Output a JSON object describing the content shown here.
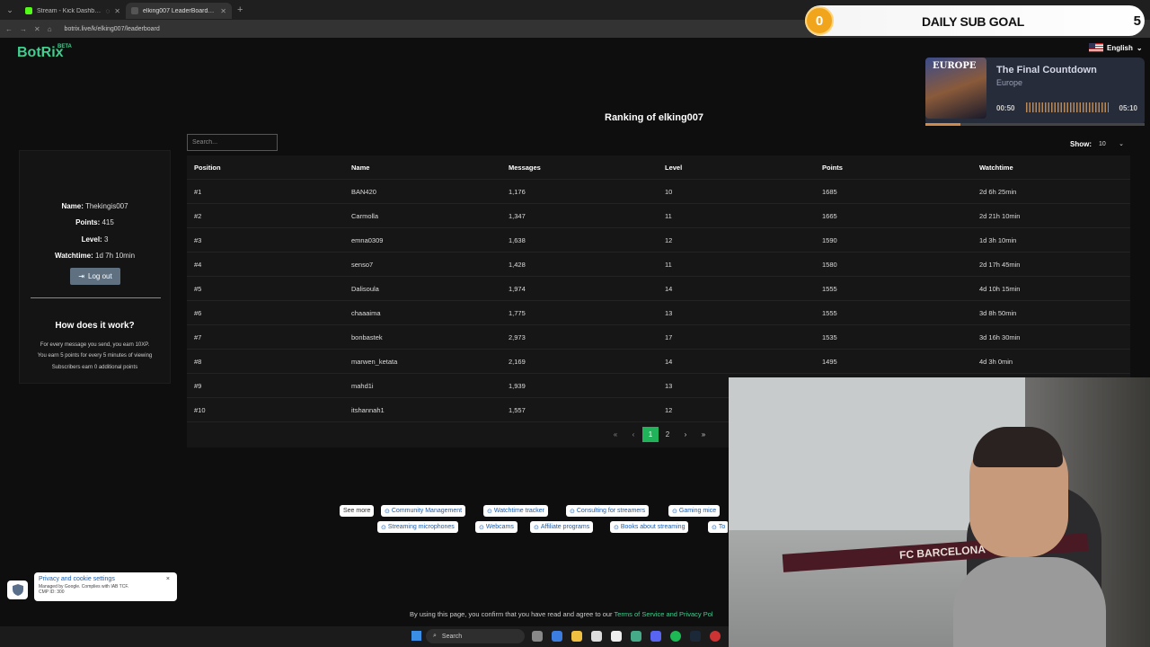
{
  "browser": {
    "tabs": [
      {
        "title": "Stream - Kick Dashboard",
        "active": false,
        "favicon_color": "#53fc18"
      },
      {
        "title": "elking007 LeaderBoard | The b",
        "active": true,
        "favicon_color": "#3fcf8e"
      }
    ],
    "url": "botrix.live/k/elking007/leaderboard"
  },
  "overlay": {
    "sub_count": "0",
    "goal_label": "DAILY SUB GOAL",
    "goal_target": "5"
  },
  "music": {
    "album_text": "EUROPE",
    "song": "The Final Countdown",
    "artist": "Europe",
    "elapsed": "00:50",
    "duration": "05:10",
    "progress": 0.16
  },
  "header": {
    "logo": "BotRix",
    "logo_badge": "BETA",
    "language": "English"
  },
  "profile": {
    "name_label": "Name:",
    "name": "Thekingis007",
    "points_label": "Points:",
    "points": "415",
    "level_label": "Level:",
    "level": "3",
    "watchtime_label": "Watchtime:",
    "watchtime": "1d 7h 10min",
    "logout": "Log out",
    "how_title": "How does it work?",
    "how_lines": [
      "For every message you send, you earn 10XP.",
      "You earn 5 points for every 5 minutes of viewing",
      "Subscribers earn 0 additional points"
    ]
  },
  "leaderboard": {
    "title": "Ranking of elking007",
    "search_placeholder": "Search...",
    "show_label": "Show:",
    "show_value": "10",
    "columns": [
      "Position",
      "Name",
      "Messages",
      "Level",
      "Points",
      "Watchtime"
    ],
    "rows": [
      [
        "#1",
        "BAN420",
        "1,176",
        "10",
        "1685",
        "2d 6h 25min"
      ],
      [
        "#2",
        "Carmolla",
        "1,347",
        "11",
        "1665",
        "2d 21h 10min"
      ],
      [
        "#3",
        "emna0309",
        "1,638",
        "12",
        "1590",
        "1d 3h 10min"
      ],
      [
        "#4",
        "senso7",
        "1,428",
        "11",
        "1580",
        "2d 17h 45min"
      ],
      [
        "#5",
        "Dalisoula",
        "1,974",
        "14",
        "1555",
        "4d 10h 15min"
      ],
      [
        "#6",
        "chaaaima",
        "1,775",
        "13",
        "1555",
        "3d 8h 50min"
      ],
      [
        "#7",
        "bonbastek",
        "2,973",
        "17",
        "1535",
        "3d 16h 30min"
      ],
      [
        "#8",
        "marwen_ketata",
        "2,169",
        "14",
        "1495",
        "4d 3h 0min"
      ],
      [
        "#9",
        "mahd1i",
        "1,939",
        "13",
        "",
        ""
      ],
      [
        "#10",
        "itshannah1",
        "1,557",
        "12",
        "",
        ""
      ]
    ],
    "pages": [
      "«",
      "‹",
      "1",
      "2",
      "›",
      "»"
    ],
    "current_page": "1"
  },
  "tags": {
    "see_more": "See more",
    "row1": [
      "Community Management",
      "Watchtime tracker",
      "Consulting for streamers",
      "Gaming mice"
    ],
    "row2": [
      "Streaming microphones",
      "Webcams",
      "Affiliate programs",
      "Books about streaming",
      "To"
    ]
  },
  "consent": {
    "text": "By using this page, you confirm that you have read and agree to our ",
    "link": "Terms of Service and Privacy Pol"
  },
  "privacy": {
    "title": "Privacy and cookie settings",
    "line1": "Managed by Google. Complies with IAB TCF.",
    "line2": "CMP ID: 300",
    "close": "×"
  },
  "webcam": {
    "scarf_text": "FC BARCELONA"
  },
  "taskbar": {
    "search": "Search"
  }
}
